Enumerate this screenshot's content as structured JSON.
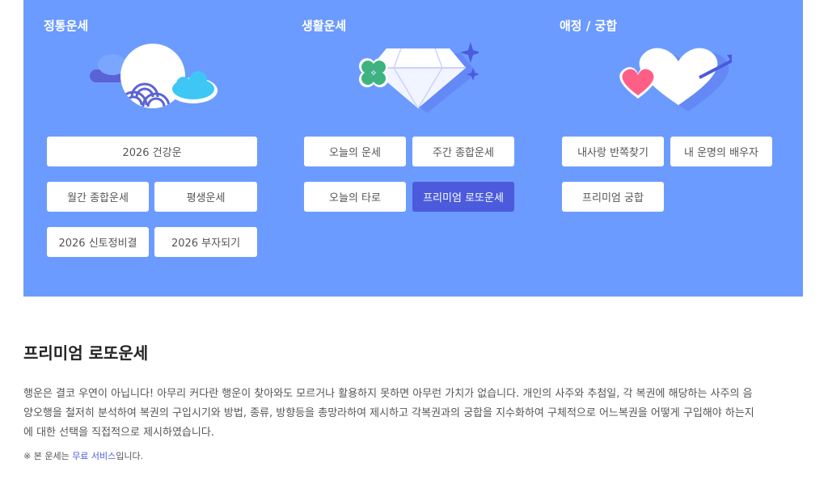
{
  "sections": [
    {
      "title": "정통운세",
      "illustration": "moon-cloud-icon",
      "buttons": [
        "2026 건강운",
        "월간 종합운세",
        "평생운세",
        "2026 신토정비결",
        "2026 부자되기"
      ]
    },
    {
      "title": "생활운세",
      "illustration": "diamond-clover-icon",
      "buttons": [
        "오늘의 운세",
        "주간 종합운세",
        "오늘의 타로",
        "프리미엄 로또운세"
      ]
    },
    {
      "title": "애정 / 궁합",
      "illustration": "hearts-arrow-icon",
      "buttons": [
        "내사랑 반쪽찾기",
        "내 운명의 배우자",
        "프리미엄 궁합"
      ]
    }
  ],
  "active_button": "프리미엄 로또운세",
  "content": {
    "title": "프리미엄 로또운세",
    "description_lines": [
      "행운은 결코 우연이 아닙니다! 아무리 커다란 행운이 찾아와도 모르거나 활용하지 못하면 아무런 가치가 없습니다. 개인의 사주와 추첨일, 각 복권에 해당하는 사주의 음",
      "양오행을 철저히 분석하여 복권의 구입시기와 방법, 종류, 방향등을 총망라하여 제시하고 각복권과의 궁합을 지수화하여 구체적으로 어느복권을 어떻게 구입해야 하는지",
      "에 대한 선택을 직접적으로 제시하였습니다."
    ],
    "note_prefix": "※ 본 운세는 ",
    "note_link": "무료 서비스",
    "note_suffix": "입니다."
  },
  "colors": {
    "panel_bg": "#6c9bff",
    "active_button": "#4b5bdc",
    "link": "#4b5bdc"
  }
}
